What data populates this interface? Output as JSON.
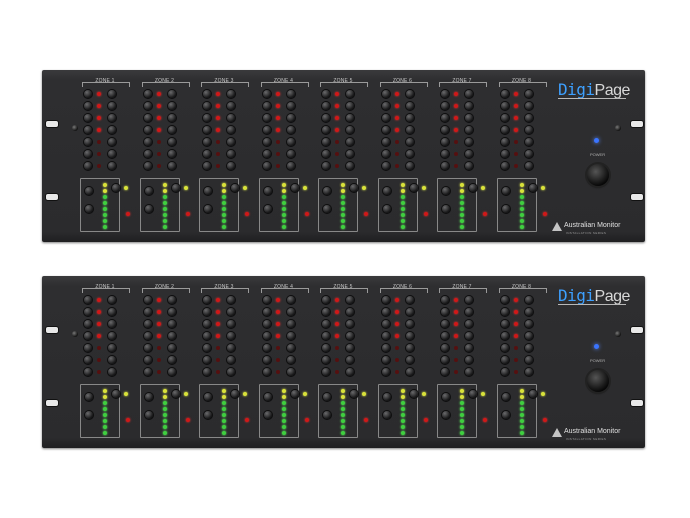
{
  "units": [
    {
      "logo": {
        "digi": "Digi",
        "page": "Page"
      },
      "brand": {
        "name": "Australian Monitor",
        "series": "INSTALLATION SERIES"
      },
      "power_label": "POWER",
      "zones": [
        "ZONE 1",
        "ZONE 2",
        "ZONE 3",
        "ZONE 4",
        "ZONE 5",
        "ZONE 6",
        "ZONE 7",
        "ZONE 8"
      ]
    },
    {
      "logo": {
        "digi": "Digi",
        "page": "Page"
      },
      "brand": {
        "name": "Australian Monitor",
        "series": "INSTALLATION SERIES"
      },
      "power_label": "POWER",
      "zones": [
        "ZONE 1",
        "ZONE 2",
        "ZONE 3",
        "ZONE 4",
        "ZONE 5",
        "ZONE 6",
        "ZONE 7",
        "ZONE 8"
      ]
    }
  ],
  "colors": {
    "panel": "#2b2b2d",
    "logo_accent": "#3da0ff",
    "led_red": "#d01818",
    "led_green": "#3fcf3f",
    "power_led": "#3a74ff"
  },
  "icons": [
    "rack-hole-icon",
    "screw-icon",
    "power-knob-icon",
    "australian-monitor-logo-icon"
  ]
}
